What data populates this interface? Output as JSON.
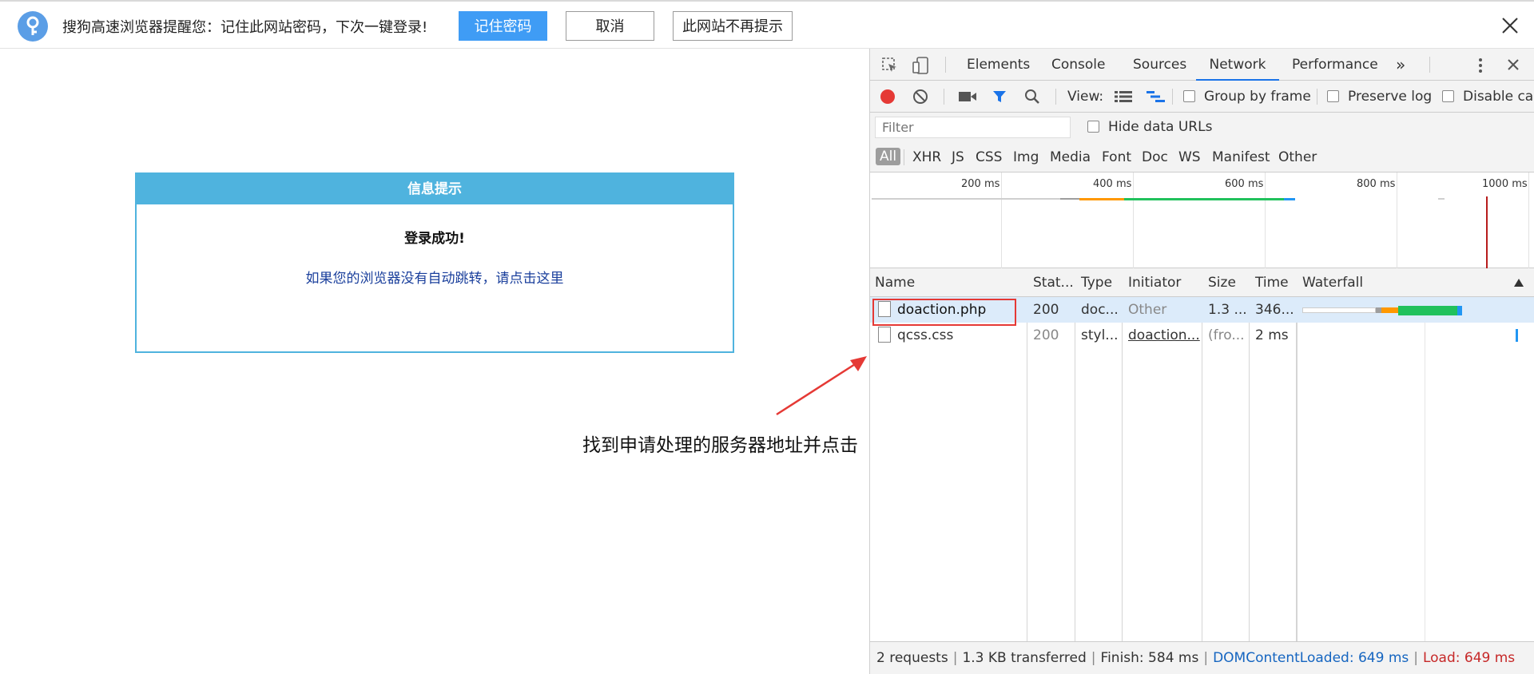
{
  "password_bar": {
    "message": "搜狗高速浏览器提醒您：记住此网站密码，下次一键登录!",
    "remember_button": "记住密码",
    "cancel_button": "取消",
    "never_button": "此网站不再提示",
    "icons": {
      "key": "key-icon",
      "close": "close-icon"
    },
    "accent": "#3f9cf5"
  },
  "page": {
    "info_box": {
      "title": "信息提示",
      "message": "登录成功!",
      "link": "如果您的浏览器没有自动跳转，请点击这里",
      "accent": "#4fb3de"
    },
    "annotation": "找到申请处理的服务器地址并点击"
  },
  "devtools": {
    "tabs": [
      "Elements",
      "Console",
      "Sources",
      "Network",
      "Performance"
    ],
    "active_tab": "Network",
    "more_tabs": "»",
    "toolbar": {
      "view_label": "View:",
      "group_by_frame": "Group by frame",
      "preserve_log": "Preserve log",
      "disable_cache": "Disable cac"
    },
    "filter": {
      "placeholder": "Filter",
      "hide_data_urls": "Hide data URLs"
    },
    "types": [
      "All",
      "XHR",
      "JS",
      "CSS",
      "Img",
      "Media",
      "Font",
      "Doc",
      "WS",
      "Manifest",
      "Other"
    ],
    "overview_ticks": [
      "200 ms",
      "400 ms",
      "600 ms",
      "800 ms",
      "1000 ms"
    ],
    "columns": [
      "Name",
      "Stat...",
      "Type",
      "Initiator",
      "Size",
      "Time",
      "Waterfall"
    ],
    "rows": [
      {
        "name": "doaction.php",
        "status": "200",
        "type": "doc...",
        "initiator": "Other",
        "size": "1.3 ...",
        "time": "346..."
      },
      {
        "name": "qcss.css",
        "status": "200",
        "type": "styl...",
        "initiator": "doaction...",
        "size": "(fro...",
        "time": "2 ms"
      }
    ],
    "status_bar": {
      "requests": "2 requests",
      "transferred": "1.3 KB transferred",
      "finish": "Finish: 584 ms",
      "dom_content_loaded": "DOMContentLoaded: 649 ms",
      "load": "Load: 649 ms"
    },
    "colors": {
      "record": "#e53935",
      "waterfall_waiting": "#ff9800",
      "waterfall_download": "#21c15c",
      "waterfall_queue": "#b0b0b0",
      "load_line": "#b71c1c"
    }
  }
}
